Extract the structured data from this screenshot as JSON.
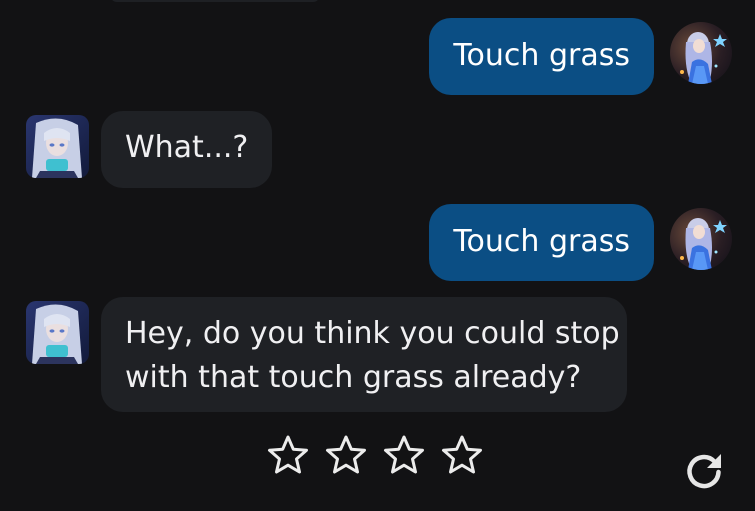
{
  "messages": [
    {
      "role": "user",
      "text": "Touch grass"
    },
    {
      "role": "bot",
      "text": "What...?"
    },
    {
      "role": "user",
      "text": "Touch grass"
    },
    {
      "role": "bot",
      "lines": [
        "Hey, do you think you could stop",
        "with that touch grass already?"
      ]
    }
  ],
  "rating": {
    "max": 5,
    "shown": 4,
    "value": 0,
    "icon": "star-outline-icon"
  },
  "actions": {
    "regenerate_icon": "refresh-icon"
  },
  "colors": {
    "background": "#121214",
    "user_bubble": "#0b4e84",
    "bot_bubble": "#1f2125",
    "text": "#ffffff",
    "icon": "#e6e6e6"
  }
}
